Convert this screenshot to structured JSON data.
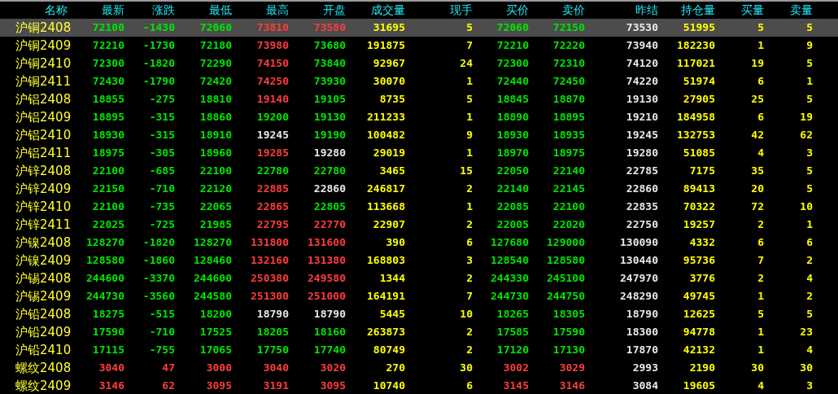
{
  "table": {
    "columns": [
      {
        "label": "名称",
        "kind": "name"
      },
      {
        "label": "最新",
        "kind": "price"
      },
      {
        "label": "涨跌",
        "kind": "change"
      },
      {
        "label": "最低",
        "kind": "price"
      },
      {
        "label": "最高",
        "kind": "price"
      },
      {
        "label": "开盘",
        "kind": "price"
      },
      {
        "label": "成交量",
        "kind": "qty"
      },
      {
        "label": "现手",
        "kind": "qty"
      },
      {
        "label": "买价",
        "kind": "price"
      },
      {
        "label": "卖价",
        "kind": "price"
      },
      {
        "label": "昨结",
        "kind": "settle"
      },
      {
        "label": "持仓量",
        "kind": "qty"
      },
      {
        "label": "买量",
        "kind": "qty"
      },
      {
        "label": "卖量",
        "kind": "qty"
      }
    ],
    "rows": [
      {
        "selected": true,
        "cells": [
          "沪铜2408",
          "72100",
          "-1430",
          "72060",
          "73810",
          "73580",
          "31695",
          "5",
          "72060",
          "72150",
          "73530",
          "51995",
          "5",
          "5"
        ]
      },
      {
        "selected": false,
        "cells": [
          "沪铜2409",
          "72210",
          "-1730",
          "72180",
          "73980",
          "73680",
          "191875",
          "7",
          "72210",
          "72220",
          "73940",
          "182230",
          "1",
          "9"
        ]
      },
      {
        "selected": false,
        "cells": [
          "沪铜2410",
          "72300",
          "-1820",
          "72290",
          "74150",
          "73840",
          "92967",
          "24",
          "72300",
          "72310",
          "74120",
          "117021",
          "19",
          "5"
        ]
      },
      {
        "selected": false,
        "cells": [
          "沪铜2411",
          "72430",
          "-1790",
          "72420",
          "74250",
          "73930",
          "30070",
          "1",
          "72440",
          "72450",
          "74220",
          "51974",
          "6",
          "1"
        ]
      },
      {
        "selected": false,
        "cells": [
          "沪铝2408",
          "18855",
          "-275",
          "18810",
          "19140",
          "19105",
          "8735",
          "5",
          "18845",
          "18870",
          "19130",
          "27905",
          "25",
          "5"
        ]
      },
      {
        "selected": false,
        "cells": [
          "沪铝2409",
          "18895",
          "-315",
          "18860",
          "19200",
          "19130",
          "211233",
          "1",
          "18890",
          "18895",
          "19210",
          "184958",
          "6",
          "19"
        ]
      },
      {
        "selected": false,
        "cells": [
          "沪铝2410",
          "18930",
          "-315",
          "18910",
          "19245",
          "19190",
          "100482",
          "9",
          "18930",
          "18935",
          "19245",
          "132753",
          "42",
          "62"
        ]
      },
      {
        "selected": false,
        "cells": [
          "沪铝2411",
          "18975",
          "-305",
          "18960",
          "19285",
          "19280",
          "29019",
          "1",
          "18970",
          "18975",
          "19280",
          "51085",
          "4",
          "3"
        ]
      },
      {
        "selected": false,
        "cells": [
          "沪锌2408",
          "22100",
          "-685",
          "22100",
          "22780",
          "22780",
          "3465",
          "15",
          "22050",
          "22140",
          "22785",
          "7175",
          "35",
          "5"
        ]
      },
      {
        "selected": false,
        "cells": [
          "沪锌2409",
          "22150",
          "-710",
          "22120",
          "22885",
          "22860",
          "246817",
          "2",
          "22140",
          "22145",
          "22860",
          "89413",
          "20",
          "5"
        ]
      },
      {
        "selected": false,
        "cells": [
          "沪锌2410",
          "22100",
          "-735",
          "22065",
          "22865",
          "22805",
          "113668",
          "1",
          "22085",
          "22100",
          "22835",
          "70322",
          "72",
          "10"
        ]
      },
      {
        "selected": false,
        "cells": [
          "沪锌2411",
          "22025",
          "-725",
          "21985",
          "22795",
          "22770",
          "22907",
          "2",
          "22005",
          "22020",
          "22750",
          "19257",
          "2",
          "1"
        ]
      },
      {
        "selected": false,
        "cells": [
          "沪镍2408",
          "128270",
          "-1820",
          "128270",
          "131800",
          "131600",
          "390",
          "6",
          "127680",
          "129000",
          "130090",
          "4332",
          "6",
          "6"
        ]
      },
      {
        "selected": false,
        "cells": [
          "沪镍2409",
          "128580",
          "-1860",
          "128460",
          "132160",
          "131380",
          "168803",
          "3",
          "128540",
          "128580",
          "130440",
          "95736",
          "7",
          "2"
        ]
      },
      {
        "selected": false,
        "cells": [
          "沪锡2408",
          "244600",
          "-3370",
          "244600",
          "250380",
          "249580",
          "1344",
          "2",
          "244330",
          "245100",
          "247970",
          "3776",
          "2",
          "4"
        ]
      },
      {
        "selected": false,
        "cells": [
          "沪锡2409",
          "244730",
          "-3560",
          "244580",
          "251300",
          "251000",
          "164191",
          "7",
          "244730",
          "244750",
          "248290",
          "49745",
          "1",
          "2"
        ]
      },
      {
        "selected": false,
        "cells": [
          "沪铅2408",
          "18275",
          "-515",
          "18200",
          "18790",
          "18790",
          "5445",
          "10",
          "18265",
          "18305",
          "18790",
          "12625",
          "5",
          "5"
        ]
      },
      {
        "selected": false,
        "cells": [
          "沪铅2409",
          "17590",
          "-710",
          "17525",
          "18205",
          "18160",
          "263873",
          "2",
          "17585",
          "17590",
          "18300",
          "94778",
          "1",
          "23"
        ]
      },
      {
        "selected": false,
        "cells": [
          "沪铅2410",
          "17115",
          "-755",
          "17065",
          "17750",
          "17740",
          "80749",
          "2",
          "17120",
          "17130",
          "17870",
          "42132",
          "1",
          "4"
        ]
      },
      {
        "selected": false,
        "cells": [
          "螺纹2408",
          "3040",
          "47",
          "3000",
          "3040",
          "3020",
          "270",
          "30",
          "3002",
          "3029",
          "2993",
          "2190",
          "30",
          "30"
        ]
      },
      {
        "selected": false,
        "cells": [
          "螺纹2409",
          "3146",
          "62",
          "3095",
          "3191",
          "3095",
          "10740",
          "6",
          "3145",
          "3146",
          "3084",
          "19605",
          "4",
          "3"
        ]
      }
    ]
  }
}
